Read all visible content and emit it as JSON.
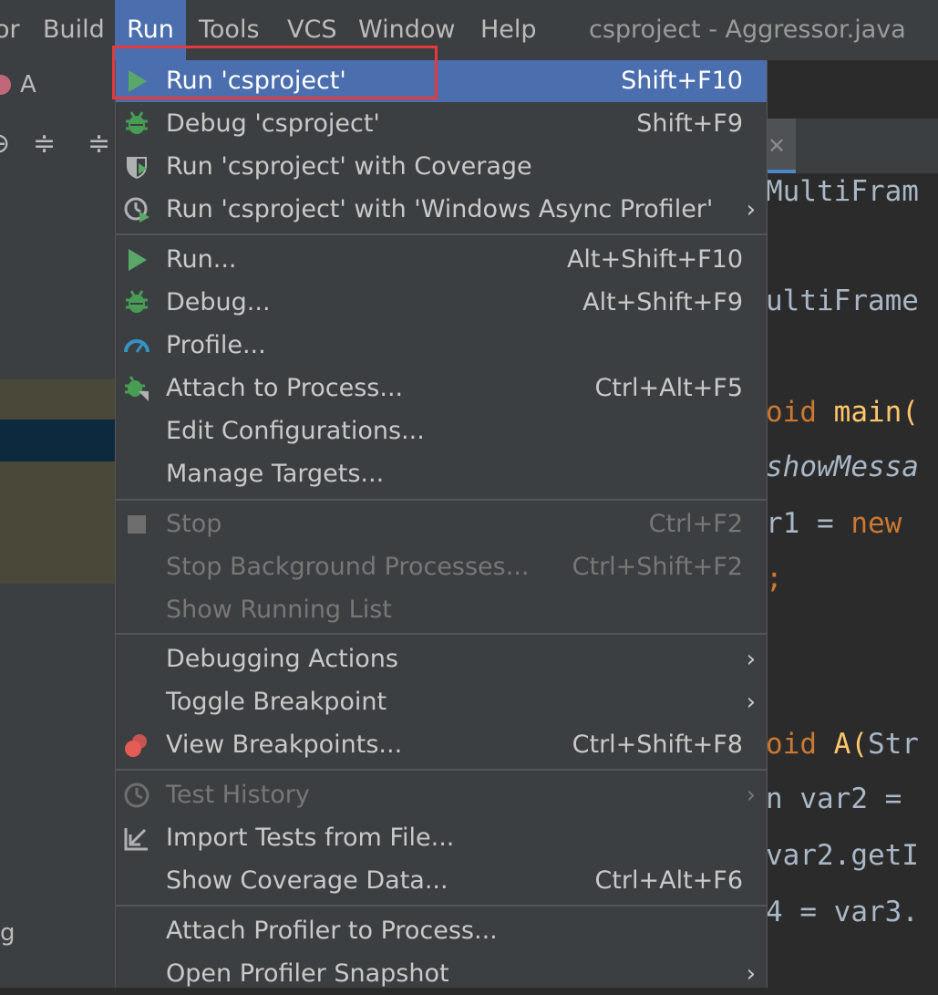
{
  "menubar": {
    "items": [
      "or",
      "Build",
      "Run",
      "Tools",
      "VCS",
      "Window",
      "Help"
    ],
    "window_title": "csproject - Aggressor.java"
  },
  "left": {
    "file_letter": "A",
    "bottom_text": "g"
  },
  "editor": {
    "lines": [
      {
        "text": "MultiFram"
      },
      {
        "text": "ultiFrame"
      },
      {
        "kw": "oid ",
        "fn": "main("
      },
      {
        "it": "showMessa"
      },
      {
        "plain": "r1 = ",
        "kw": "new"
      },
      {
        "kw": ";"
      },
      {
        "kw": "oid ",
        "fn": "A(",
        "plain": "Str"
      },
      {
        "plain": "n var2 ="
      },
      {
        "plain": "var2.getI"
      },
      {
        "plain": "4 = var3."
      }
    ]
  },
  "menu": {
    "groups": [
      [
        {
          "label": "Run 'csproject'",
          "shortcut": "Shift+F10",
          "icon": "run-play-icon",
          "selected": true
        },
        {
          "label": "Debug 'csproject'",
          "shortcut": "Shift+F9",
          "icon": "debug-bug-icon"
        },
        {
          "label": "Run 'csproject' with Coverage",
          "shortcut": "",
          "icon": "coverage-shield-icon"
        },
        {
          "label": "Run 'csproject' with 'Windows Async Profiler'",
          "shortcut": "",
          "icon": "profiler-clock-icon",
          "submenu": true
        }
      ],
      [
        {
          "label": "Run...",
          "shortcut": "Alt+Shift+F10",
          "icon": "run-play-icon"
        },
        {
          "label": "Debug...",
          "shortcut": "Alt+Shift+F9",
          "icon": "debug-bug-icon"
        },
        {
          "label": "Profile...",
          "shortcut": "",
          "icon": "profile-gauge-icon"
        },
        {
          "label": "Attach to Process...",
          "shortcut": "Ctrl+Alt+F5",
          "icon": "attach-bug-icon"
        },
        {
          "label": "Edit Configurations...",
          "shortcut": ""
        },
        {
          "label": "Manage Targets...",
          "shortcut": ""
        }
      ],
      [
        {
          "label": "Stop",
          "shortcut": "Ctrl+F2",
          "icon": "stop-square-icon",
          "disabled": true
        },
        {
          "label": "Stop Background Processes...",
          "shortcut": "Ctrl+Shift+F2",
          "disabled": true
        },
        {
          "label": "Show Running List",
          "shortcut": "",
          "disabled": true
        }
      ],
      [
        {
          "label": "Debugging Actions",
          "shortcut": "",
          "submenu": true
        },
        {
          "label": "Toggle Breakpoint",
          "shortcut": "",
          "submenu": true
        },
        {
          "label": "View Breakpoints...",
          "shortcut": "Ctrl+Shift+F8",
          "icon": "breakpoints-icon"
        }
      ],
      [
        {
          "label": "Test History",
          "shortcut": "",
          "icon": "history-clock-icon",
          "disabled": true,
          "submenu": true
        },
        {
          "label": "Import Tests from File...",
          "shortcut": "",
          "icon": "import-arrow-icon"
        },
        {
          "label": "Show Coverage Data...",
          "shortcut": "Ctrl+Alt+F6"
        }
      ],
      [
        {
          "label": "Attach Profiler to Process...",
          "shortcut": ""
        },
        {
          "label": "Open Profiler Snapshot",
          "shortcut": "",
          "submenu": true
        }
      ]
    ]
  },
  "colors": {
    "selected": "#4b6eaf",
    "highlight_box": "#e5393b",
    "run_green": "#59a869",
    "bug_green": "#499c54"
  }
}
